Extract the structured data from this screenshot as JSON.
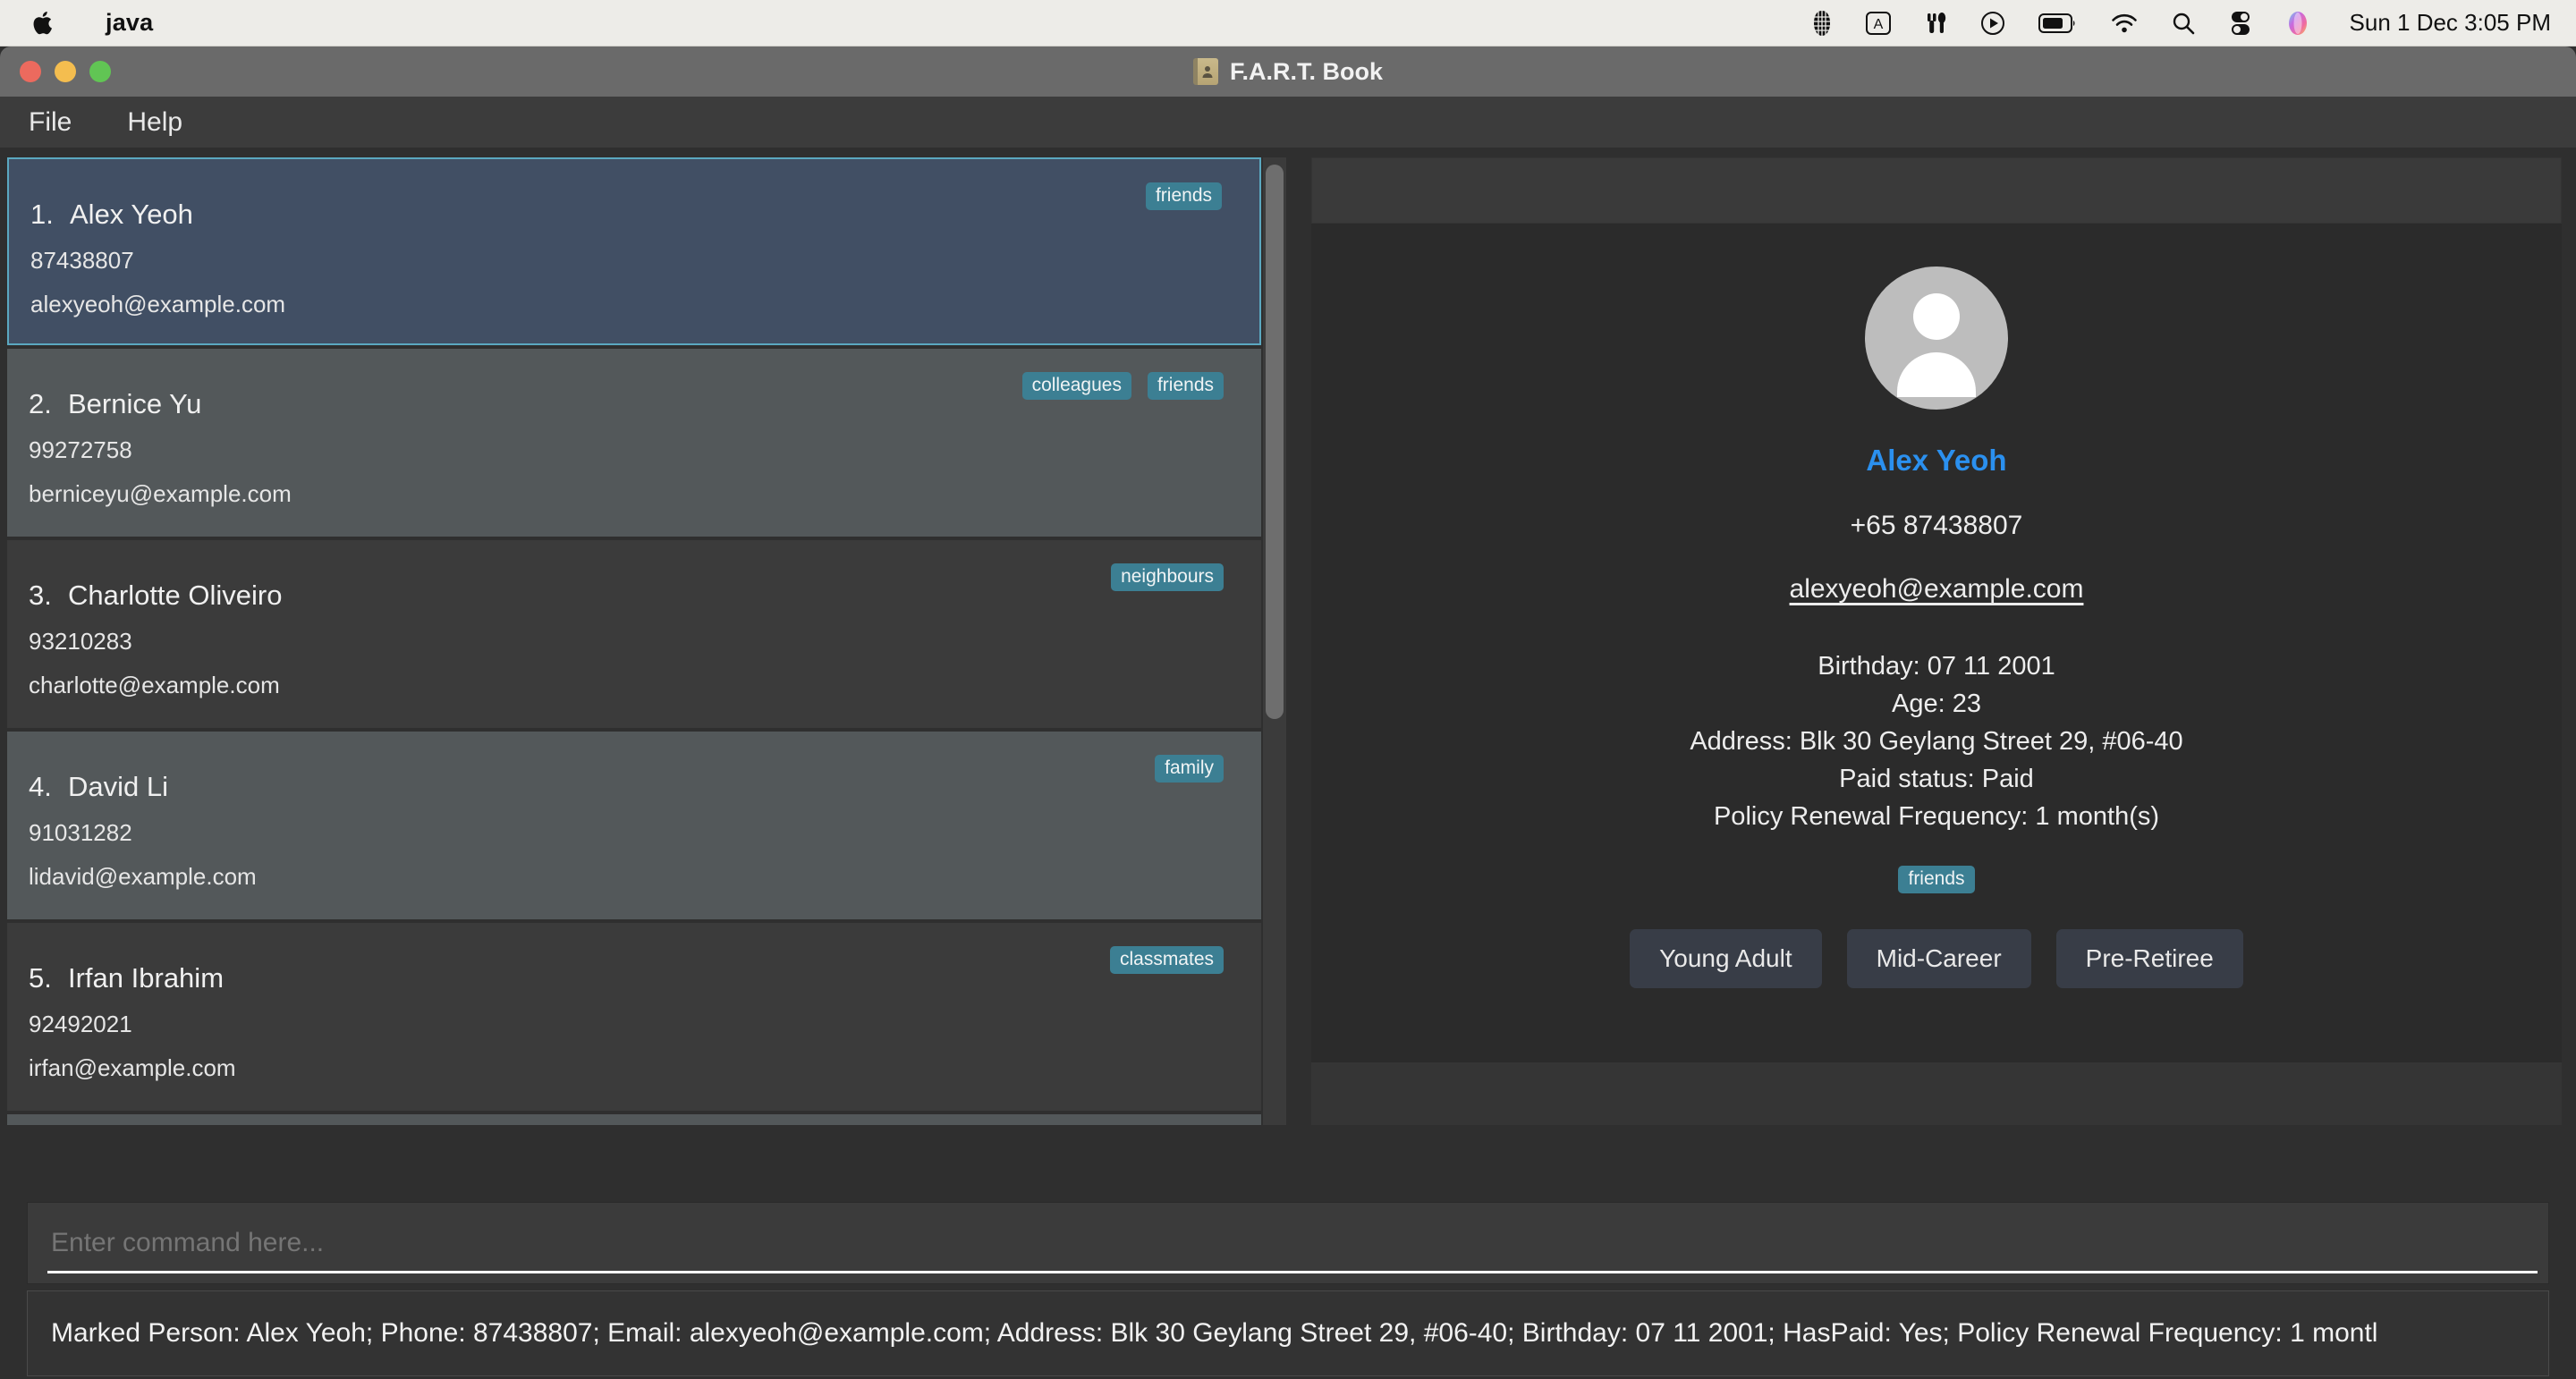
{
  "os_menubar": {
    "app_name": "java",
    "apple_icon": "apple-logo-icon",
    "status_icons": [
      {
        "name": "grid-icon"
      },
      {
        "name": "keyboard-input-a-icon"
      },
      {
        "name": "utensils-icon"
      },
      {
        "name": "play-circle-icon"
      },
      {
        "name": "battery-icon"
      },
      {
        "name": "wifi-icon"
      },
      {
        "name": "search-icon"
      },
      {
        "name": "control-center-icon"
      },
      {
        "name": "siri-icon"
      }
    ],
    "clock": "Sun 1 Dec  3:05 PM"
  },
  "window": {
    "title": "F.A.R.T. Book",
    "title_icon": "address-book-icon",
    "traffic_lights": {
      "close": "close-button",
      "minimize": "minimize-button",
      "zoom": "zoom-button"
    }
  },
  "menu": {
    "items": [
      {
        "label": "File"
      },
      {
        "label": "Help"
      }
    ]
  },
  "person_list": [
    {
      "index": "1.",
      "name": "Alex Yeoh",
      "phone": "87438807",
      "email": "alexyeoh@example.com",
      "tags": [
        "friends"
      ],
      "selected": true
    },
    {
      "index": "2.",
      "name": "Bernice Yu",
      "phone": "99272758",
      "email": "berniceyu@example.com",
      "tags": [
        "colleagues",
        "friends"
      ],
      "selected": false
    },
    {
      "index": "3.",
      "name": "Charlotte Oliveiro",
      "phone": "93210283",
      "email": "charlotte@example.com",
      "tags": [
        "neighbours"
      ],
      "selected": false
    },
    {
      "index": "4.",
      "name": "David Li",
      "phone": "91031282",
      "email": "lidavid@example.com",
      "tags": [
        "family"
      ],
      "selected": false
    },
    {
      "index": "5.",
      "name": "Irfan Ibrahim",
      "phone": "92492021",
      "email": "irfan@example.com",
      "tags": [
        "classmates"
      ],
      "selected": false
    }
  ],
  "detail": {
    "avatar_icon": "person-avatar-icon",
    "name": "Alex Yeoh",
    "phone": "+65 87438807",
    "email": "alexyeoh@example.com",
    "lines": [
      "Birthday: 07 11 2001",
      "Age: 23",
      "Address: Blk 30 Geylang Street 29, #06-40",
      "Paid status: Paid",
      "Policy Renewal Frequency: 1 month(s)"
    ],
    "tags": [
      "friends"
    ],
    "stage_buttons": [
      {
        "label": "Young Adult"
      },
      {
        "label": "Mid-Career"
      },
      {
        "label": "Pre-Retiree"
      }
    ]
  },
  "command": {
    "placeholder": "Enter command here...",
    "value": ""
  },
  "result": {
    "text": "Marked Person: Alex Yeoh; Phone: 87438807; Email: alexyeoh@example.com; Address: Blk 30 Geylang Street 29, #06-40; Birthday: 07 11 2001; HasPaid: Yes; Policy Renewal Frequency: 1 montl"
  },
  "colors": {
    "accent_blue": "#2b90ef",
    "tag_teal": "#3c7f93",
    "selected_row": "#414f64",
    "selected_border": "#5ba8c0",
    "window_bg": "#2f2f2f"
  }
}
